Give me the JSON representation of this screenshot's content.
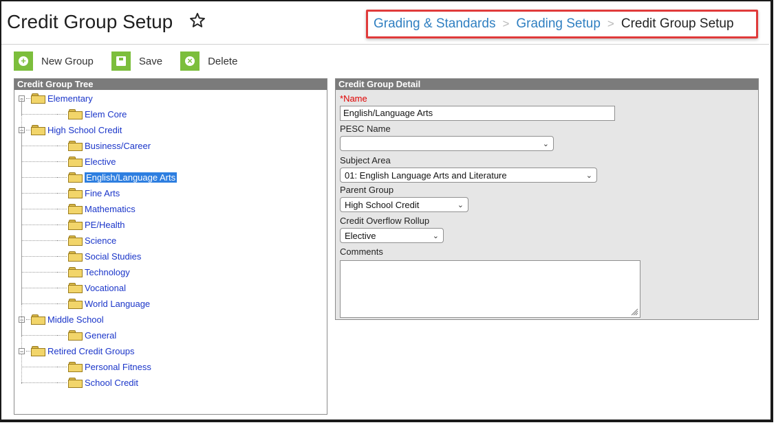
{
  "header": {
    "title": "Credit Group Setup",
    "breadcrumb": [
      "Grading & Standards",
      "Grading Setup",
      "Credit Group Setup"
    ]
  },
  "toolbar": {
    "new_label": "New Group",
    "save_label": "Save",
    "delete_label": "Delete"
  },
  "tree": {
    "title": "Credit Group Tree",
    "groups": [
      {
        "label": "Elementary",
        "children": [
          "Elem Core"
        ]
      },
      {
        "label": "High School Credit",
        "children": [
          "Business/Career",
          "Elective",
          "English/Language Arts",
          "Fine Arts",
          "Mathematics",
          "PE/Health",
          "Science",
          "Social Studies",
          "Technology",
          "Vocational",
          "World Language"
        ]
      },
      {
        "label": "Middle School",
        "children": [
          "General"
        ]
      },
      {
        "label": "Retired Credit Groups",
        "children": [
          "Personal Fitness",
          "School Credit"
        ]
      }
    ],
    "selected": "English/Language Arts"
  },
  "detail": {
    "title": "Credit Group Detail",
    "name_label": "Name",
    "name_required_mark": "*",
    "name_value": "English/Language Arts",
    "pesc_label": "PESC Name",
    "pesc_value": "",
    "subject_label": "Subject Area",
    "subject_value": "01: English Language Arts and Literature",
    "parent_label": "Parent Group",
    "parent_value": "High School Credit",
    "overflow_label": "Credit Overflow Rollup",
    "overflow_value": "Elective",
    "comments_label": "Comments",
    "comments_value": ""
  },
  "colors": {
    "accent_green": "#7cbe3c",
    "link_blue": "#1a35c9",
    "breadcrumb_highlight": "#e03a3a",
    "selection": "#2d7ee0"
  },
  "icons": [
    "star-icon",
    "plus-icon",
    "save-icon",
    "delete-icon",
    "folder-icon",
    "chevron-down-icon",
    "resize-grip-icon"
  ]
}
